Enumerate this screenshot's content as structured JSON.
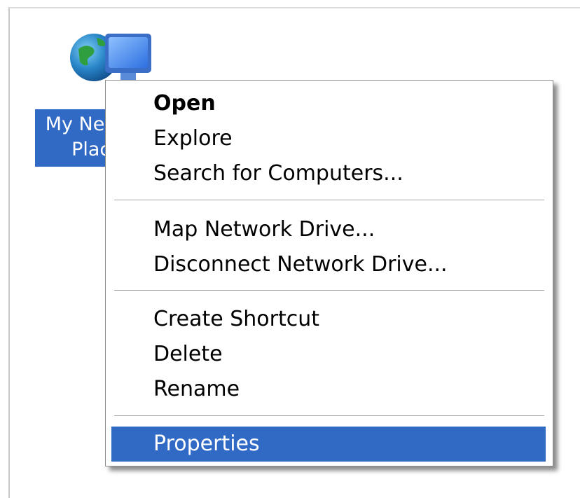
{
  "desktop_icon": {
    "icon": "network-places-icon",
    "label_line1": "My Network",
    "label_line2": "Places",
    "selection_color": "#316ac5"
  },
  "context_menu": {
    "items": [
      {
        "label": "Open",
        "default": true
      },
      {
        "label": "Explore"
      },
      {
        "label": "Search for Computers..."
      },
      {
        "label": "Map Network Drive..."
      },
      {
        "label": "Disconnect Network Drive..."
      },
      {
        "label": "Create Shortcut"
      },
      {
        "label": "Delete"
      },
      {
        "label": "Rename"
      },
      {
        "label": "Properties",
        "highlighted": true
      }
    ],
    "highlight_color": "#316ac5"
  }
}
